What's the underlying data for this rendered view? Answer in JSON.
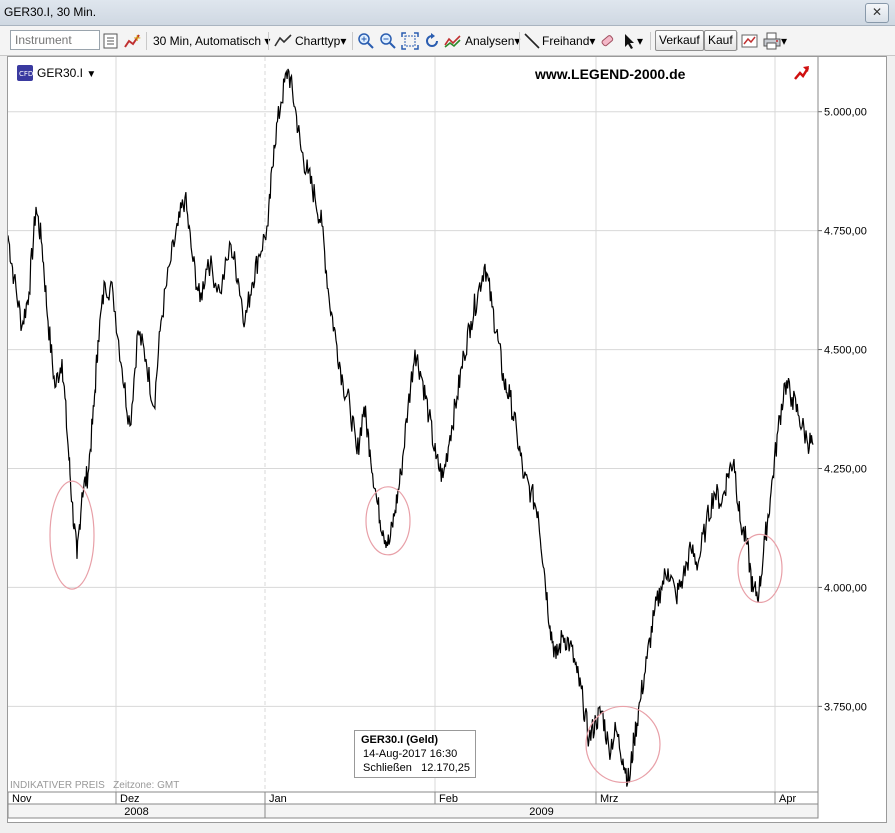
{
  "window": {
    "title": "GER30.I, 30 Min.",
    "close_label": "✕"
  },
  "toolbar": {
    "instrument_placeholder": "Instrument",
    "interval_label": "30 Min,",
    "mode_label": "Automatisch",
    "charttype_label": "Charttyp",
    "analysen_label": "Analysen",
    "freihand_label": "Freihand",
    "verkauf_label": "Verkauf",
    "kauf_label": "Kauf"
  },
  "chart": {
    "symbol": "GER30.I",
    "watermark": "www.LEGEND-2000.de",
    "footer_note": "INDIKATIVER PREIS   Zeitzone: GMT",
    "tooltip": {
      "title": "GER30.I (Geld)",
      "datetime": "14-Aug-2017 16:30",
      "close_label": "Schließen",
      "close_value": "12.170,25"
    }
  },
  "chart_data": {
    "type": "line",
    "series_color": "#000000",
    "y_ticks": [
      {
        "value": 5000,
        "label": "5.000,00"
      },
      {
        "value": 4750,
        "label": "4.750,00"
      },
      {
        "value": 4500,
        "label": "4.500,00"
      },
      {
        "value": 4250,
        "label": "4.250,00"
      },
      {
        "value": 4000,
        "label": "4.000,00"
      },
      {
        "value": 3750,
        "label": "3.750,00"
      }
    ],
    "ylim": [
      3570,
      5115
    ],
    "months": [
      "Nov",
      "Dez",
      "Jan",
      "Feb",
      "Mrz",
      "Apr"
    ],
    "years": [
      "2008",
      "2009"
    ],
    "points": [
      [
        0,
        4740
      ],
      [
        0.6,
        4650
      ],
      [
        1.4,
        4550
      ],
      [
        2.1,
        4620
      ],
      [
        2.8,
        4800
      ],
      [
        3.4,
        4720
      ],
      [
        4.0,
        4560
      ],
      [
        4.7,
        4420
      ],
      [
        5.4,
        4480
      ],
      [
        6.0,
        4300
      ],
      [
        6.4,
        4180
      ],
      [
        6.9,
        4060
      ],
      [
        7.4,
        4200
      ],
      [
        8.0,
        4240
      ],
      [
        8.6,
        4380
      ],
      [
        9.0,
        4520
      ],
      [
        9.7,
        4640
      ],
      [
        10.5,
        4620
      ],
      [
        11.4,
        4460
      ],
      [
        12.2,
        4340
      ],
      [
        13.0,
        4540
      ],
      [
        13.8,
        4480
      ],
      [
        14.6,
        4380
      ],
      [
        15.3,
        4560
      ],
      [
        16.2,
        4680
      ],
      [
        17.0,
        4760
      ],
      [
        17.7,
        4820
      ],
      [
        18.4,
        4700
      ],
      [
        19.2,
        4600
      ],
      [
        20.0,
        4690
      ],
      [
        21.2,
        4620
      ],
      [
        22.3,
        4720
      ],
      [
        23.0,
        4650
      ],
      [
        23.7,
        4560
      ],
      [
        24.4,
        4640
      ],
      [
        25.1,
        4700
      ],
      [
        26.0,
        4760
      ],
      [
        26.6,
        4930
      ],
      [
        27.3,
        5020
      ],
      [
        28.0,
        5090
      ],
      [
        28.7,
        5010
      ],
      [
        29.3,
        4920
      ],
      [
        30.0,
        4870
      ],
      [
        30.7,
        4820
      ],
      [
        31.4,
        4760
      ],
      [
        32.1,
        4610
      ],
      [
        32.8,
        4520
      ],
      [
        33.5,
        4430
      ],
      [
        34.2,
        4380
      ],
      [
        34.9,
        4280
      ],
      [
        35.6,
        4380
      ],
      [
        36.2,
        4290
      ],
      [
        36.9,
        4180
      ],
      [
        37.5,
        4120
      ],
      [
        38.1,
        4090
      ],
      [
        38.7,
        4160
      ],
      [
        39.3,
        4240
      ],
      [
        40.0,
        4380
      ],
      [
        40.7,
        4500
      ],
      [
        41.4,
        4440
      ],
      [
        42.1,
        4360
      ],
      [
        42.8,
        4270
      ],
      [
        43.5,
        4230
      ],
      [
        44.2,
        4320
      ],
      [
        44.9,
        4400
      ],
      [
        45.6,
        4490
      ],
      [
        46.3,
        4560
      ],
      [
        47.0,
        4620
      ],
      [
        47.7,
        4680
      ],
      [
        48.4,
        4590
      ],
      [
        49.0,
        4520
      ],
      [
        49.6,
        4430
      ],
      [
        50.2,
        4400
      ],
      [
        50.9,
        4320
      ],
      [
        51.6,
        4230
      ],
      [
        52.3,
        4200
      ],
      [
        53.0,
        4160
      ],
      [
        53.6,
        4040
      ],
      [
        54.2,
        3920
      ],
      [
        54.8,
        3850
      ],
      [
        55.5,
        3900
      ],
      [
        56.2,
        3880
      ],
      [
        56.9,
        3820
      ],
      [
        57.5,
        3760
      ],
      [
        58.1,
        3680
      ],
      [
        58.8,
        3720
      ],
      [
        59.4,
        3740
      ],
      [
        60.1,
        3660
      ],
      [
        60.8,
        3700
      ],
      [
        61.5,
        3640
      ],
      [
        62.1,
        3590
      ],
      [
        62.6,
        3680
      ],
      [
        63.2,
        3760
      ],
      [
        63.9,
        3850
      ],
      [
        64.6,
        3940
      ],
      [
        65.3,
        4000
      ],
      [
        66.0,
        4040
      ],
      [
        66.8,
        3980
      ],
      [
        67.5,
        4020
      ],
      [
        68.3,
        4080
      ],
      [
        69.0,
        4050
      ],
      [
        69.8,
        4130
      ],
      [
        70.6,
        4200
      ],
      [
        71.4,
        4180
      ],
      [
        72.0,
        4240
      ],
      [
        72.6,
        4270
      ],
      [
        73.2,
        4140
      ],
      [
        73.9,
        4090
      ],
      [
        74.5,
        3990
      ],
      [
        75.1,
        3990
      ],
      [
        75.7,
        4100
      ],
      [
        76.3,
        4200
      ],
      [
        77.0,
        4330
      ],
      [
        77.7,
        4430
      ],
      [
        78.4,
        4400
      ],
      [
        79.1,
        4360
      ],
      [
        79.9,
        4310
      ],
      [
        80.5,
        4300
      ]
    ],
    "ellipses": [
      {
        "x": 6.4,
        "y": 4110,
        "label": ""
      },
      {
        "x": 38.0,
        "y": 4140,
        "label": ""
      },
      {
        "x": 61.5,
        "y": 3670,
        "label": ""
      },
      {
        "x": 75.2,
        "y": 4040,
        "label": ""
      }
    ]
  }
}
